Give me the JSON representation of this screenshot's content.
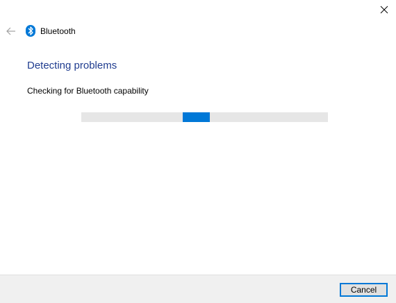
{
  "window": {
    "title": "Bluetooth",
    "close_icon": "close-icon",
    "back_icon": "back-arrow-icon",
    "app_icon": "bluetooth-icon"
  },
  "main": {
    "heading": "Detecting problems",
    "status": "Checking for Bluetooth capability",
    "progress": {
      "mode": "indeterminate",
      "accent_color": "#0078d7",
      "track_color": "#e6e6e6"
    }
  },
  "footer": {
    "cancel_label": "Cancel"
  },
  "colors": {
    "accent": "#0078d7",
    "heading": "#1f3c8f",
    "footer_bg": "#f0f0f0"
  }
}
